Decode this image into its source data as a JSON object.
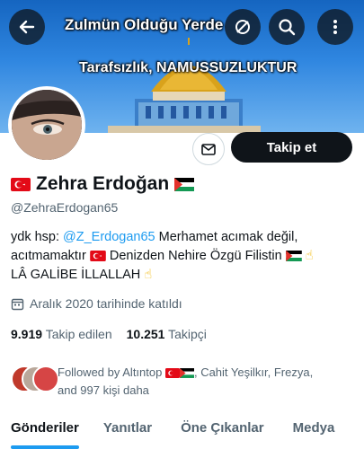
{
  "banner": {
    "text_top": "Zulmün Olduğu Yerde",
    "text_bottom": "Tarafsızlık, NAMUSSUZLUKTUR"
  },
  "header_icons": [
    "back-arrow-icon",
    "mute-icon",
    "search-icon",
    "more-vertical-icon"
  ],
  "actions": {
    "message_icon": "mail-icon",
    "follow_label": "Takip et"
  },
  "profile": {
    "name": "Zehra Erdoğan",
    "handle": "@ZehraErdogan65",
    "bio": {
      "prefix": "ydk hsp: ",
      "mention": "@Z_Erdogan65",
      "line1_rest": " Merhamet acımak değil,",
      "line2_a": "acıtmamaktır ",
      "line2_b": " Denizden Nehire Özgü Filistin ",
      "line3": "LÂ GALİBE İLLALLAH ",
      "hand_emoji": "☝"
    },
    "joined": "Aralık 2020 tarihinde katıldı",
    "following_count": "9.919",
    "following_label": "Takip edilen",
    "followers_count": "10.251",
    "followers_label": "Takipçi"
  },
  "followed_by": {
    "prefix": "Followed by Altıntop ",
    "rest": ", Cahit Yeşilkır, Frezya,",
    "line2": "and 997 kişi daha"
  },
  "tabs": [
    {
      "label": "Gönderiler",
      "active": true
    },
    {
      "label": "Yanıtlar",
      "active": false
    },
    {
      "label": "Öne Çıkanlar",
      "active": false
    },
    {
      "label": "Medya",
      "active": false
    }
  ],
  "colors": {
    "accent": "#1d9bf0",
    "text": "#0f1419",
    "muted": "#536471",
    "button_dark": "#0f1419"
  }
}
